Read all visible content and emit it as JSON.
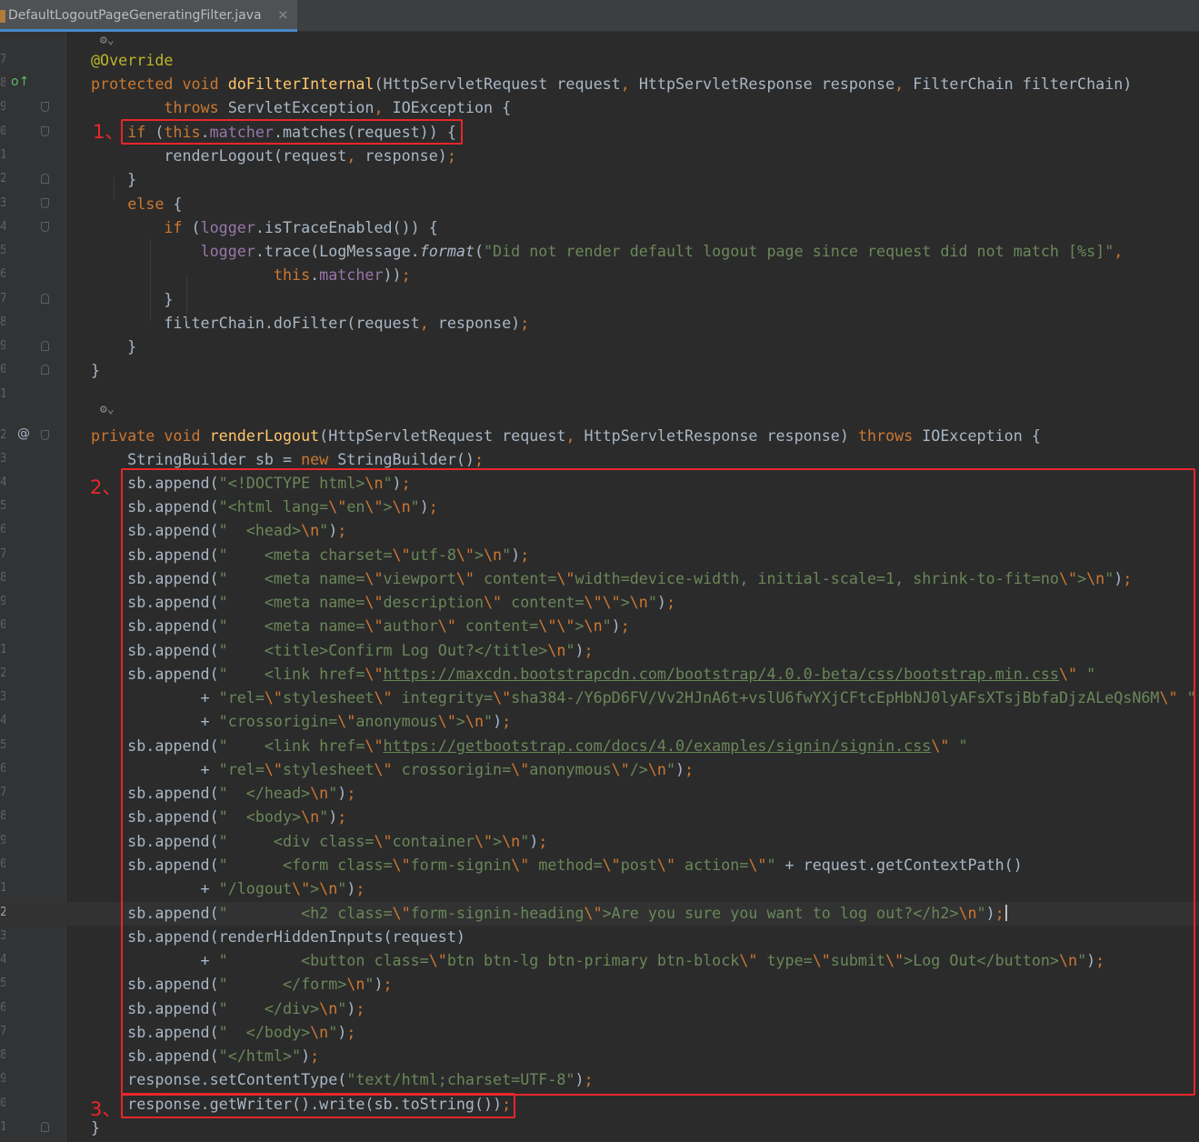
{
  "tab": {
    "filename": "DefaultLogoutPageGeneratingFilter.java",
    "close": "×"
  },
  "gutter_marks": {
    "override": "o↑",
    "annotation": "@"
  },
  "annotations": [
    "1、",
    "2、",
    "3、"
  ],
  "theme": {
    "background": "#2b2b2b",
    "keyword": "#cc7832",
    "string": "#6a8759",
    "method": "#ffc66d",
    "field": "#9876aa",
    "annotation": "#bbb529",
    "highlight": "#e8262b"
  },
  "lines": [
    {
      "n": "",
      "hint": "⚙⌄",
      "tokens": []
    },
    {
      "n": "7",
      "tokens": [
        [
          "a",
          "@Override"
        ]
      ]
    },
    {
      "n": "8",
      "mark": "override",
      "tokens": [
        [
          "k",
          "protected void "
        ],
        [
          "f",
          "doFilterInternal"
        ],
        [
          "p",
          "(HttpServletRequest request"
        ],
        [
          "k",
          ", "
        ],
        [
          "p",
          "HttpServletResponse response"
        ],
        [
          "k",
          ", "
        ],
        [
          "p",
          "FilterChain filterChain)"
        ]
      ]
    },
    {
      "n": "9",
      "fold": "down",
      "tokens": [
        [
          "p",
          "        "
        ],
        [
          "k",
          "throws "
        ],
        [
          "p",
          "ServletException"
        ],
        [
          "k",
          ", "
        ],
        [
          "p",
          "IOException {"
        ]
      ]
    },
    {
      "n": "0",
      "fold": "down",
      "tokens": [
        [
          "p",
          "    "
        ],
        [
          "k",
          "if "
        ],
        [
          "p",
          "("
        ],
        [
          "k",
          "this"
        ],
        [
          "p",
          "."
        ],
        [
          "m",
          "matcher"
        ],
        [
          "p",
          ".matches(request)) {"
        ]
      ]
    },
    {
      "n": "1",
      "tokens": [
        [
          "p",
          "        renderLogout(request"
        ],
        [
          "k",
          ", "
        ],
        [
          "p",
          "response)"
        ],
        [
          "k",
          ";"
        ]
      ]
    },
    {
      "n": "2",
      "fold": "up",
      "tokens": [
        [
          "p",
          "    }"
        ]
      ]
    },
    {
      "n": "3",
      "fold": "down",
      "tokens": [
        [
          "p",
          "    "
        ],
        [
          "k",
          "else "
        ],
        [
          "p",
          "{"
        ]
      ]
    },
    {
      "n": "4",
      "fold": "down",
      "tokens": [
        [
          "p",
          "        "
        ],
        [
          "k",
          "if "
        ],
        [
          "p",
          "("
        ],
        [
          "m",
          "logger"
        ],
        [
          "p",
          ".isTraceEnabled()) {"
        ]
      ]
    },
    {
      "n": "5",
      "tokens": [
        [
          "p",
          "            "
        ],
        [
          "m",
          "logger"
        ],
        [
          "p",
          ".trace(LogMessage."
        ],
        [
          "i",
          "format"
        ],
        [
          "p",
          "("
        ],
        [
          "s",
          "\"Did not render default logout page since request did not match [%s]\""
        ],
        [
          "k",
          ","
        ]
      ]
    },
    {
      "n": "6",
      "tokens": [
        [
          "p",
          "                    "
        ],
        [
          "k",
          "this"
        ],
        [
          "p",
          "."
        ],
        [
          "m",
          "matcher"
        ],
        [
          "p",
          "))"
        ],
        [
          "k",
          ";"
        ]
      ]
    },
    {
      "n": "7",
      "fold": "up",
      "tokens": [
        [
          "p",
          "        }"
        ]
      ]
    },
    {
      "n": "8",
      "tokens": [
        [
          "p",
          "        filterChain.doFilter(request"
        ],
        [
          "k",
          ", "
        ],
        [
          "p",
          "response)"
        ],
        [
          "k",
          ";"
        ]
      ]
    },
    {
      "n": "9",
      "fold": "up",
      "tokens": [
        [
          "p",
          "    }"
        ]
      ]
    },
    {
      "n": "0",
      "fold": "up",
      "tokens": [
        [
          "p",
          "}"
        ]
      ]
    },
    {
      "n": "1",
      "tokens": []
    },
    {
      "n": "",
      "hint": "⚙⌄",
      "tokens": []
    },
    {
      "n": "2",
      "mark": "annotation",
      "fold": "down",
      "tokens": [
        [
          "k",
          "private void "
        ],
        [
          "f",
          "renderLogout"
        ],
        [
          "p",
          "(HttpServletRequest request"
        ],
        [
          "k",
          ", "
        ],
        [
          "p",
          "HttpServletResponse response) "
        ],
        [
          "k",
          "throws "
        ],
        [
          "p",
          "IOException {"
        ]
      ]
    },
    {
      "n": "3",
      "tokens": [
        [
          "p",
          "    StringBuilder sb = "
        ],
        [
          "k",
          "new "
        ],
        [
          "p",
          "StringBuilder()"
        ],
        [
          "k",
          ";"
        ]
      ]
    },
    {
      "n": "4",
      "tokens": [
        [
          "p",
          "    sb.append("
        ],
        [
          "s",
          "\"<!DOCTYPE html>"
        ],
        [
          "k",
          "\\n"
        ],
        [
          "s",
          "\""
        ],
        [
          "p",
          ")"
        ],
        [
          "k",
          ";"
        ]
      ]
    },
    {
      "n": "5",
      "tokens": [
        [
          "p",
          "    sb.append("
        ],
        [
          "s",
          "\"<html lang="
        ],
        [
          "k",
          "\\\""
        ],
        [
          "s",
          "en"
        ],
        [
          "k",
          "\\\""
        ],
        [
          "s",
          ">"
        ],
        [
          "k",
          "\\n"
        ],
        [
          "s",
          "\""
        ],
        [
          "p",
          ")"
        ],
        [
          "k",
          ";"
        ]
      ]
    },
    {
      "n": "6",
      "tokens": [
        [
          "p",
          "    sb.append("
        ],
        [
          "s",
          "\"  <head>"
        ],
        [
          "k",
          "\\n"
        ],
        [
          "s",
          "\""
        ],
        [
          "p",
          ")"
        ],
        [
          "k",
          ";"
        ]
      ]
    },
    {
      "n": "7",
      "tokens": [
        [
          "p",
          "    sb.append("
        ],
        [
          "s",
          "\"    <meta charset="
        ],
        [
          "k",
          "\\\""
        ],
        [
          "s",
          "utf-8"
        ],
        [
          "k",
          "\\\""
        ],
        [
          "s",
          ">"
        ],
        [
          "k",
          "\\n"
        ],
        [
          "s",
          "\""
        ],
        [
          "p",
          ")"
        ],
        [
          "k",
          ";"
        ]
      ]
    },
    {
      "n": "8",
      "tokens": [
        [
          "p",
          "    sb.append("
        ],
        [
          "s",
          "\"    <meta name="
        ],
        [
          "k",
          "\\\""
        ],
        [
          "s",
          "viewport"
        ],
        [
          "k",
          "\\\""
        ],
        [
          "s",
          " content="
        ],
        [
          "k",
          "\\\""
        ],
        [
          "s",
          "width=device-width, initial-scale=1, shrink-to-fit=no"
        ],
        [
          "k",
          "\\\""
        ],
        [
          "s",
          ">"
        ],
        [
          "k",
          "\\n"
        ],
        [
          "s",
          "\""
        ],
        [
          "p",
          ")"
        ],
        [
          "k",
          ";"
        ]
      ]
    },
    {
      "n": "9",
      "tokens": [
        [
          "p",
          "    sb.append("
        ],
        [
          "s",
          "\"    <meta name="
        ],
        [
          "k",
          "\\\""
        ],
        [
          "s",
          "description"
        ],
        [
          "k",
          "\\\""
        ],
        [
          "s",
          " content="
        ],
        [
          "k",
          "\\\"\\\""
        ],
        [
          "s",
          ">"
        ],
        [
          "k",
          "\\n"
        ],
        [
          "s",
          "\""
        ],
        [
          "p",
          ")"
        ],
        [
          "k",
          ";"
        ]
      ]
    },
    {
      "n": "0",
      "tokens": [
        [
          "p",
          "    sb.append("
        ],
        [
          "s",
          "\"    <meta name="
        ],
        [
          "k",
          "\\\""
        ],
        [
          "s",
          "author"
        ],
        [
          "k",
          "\\\""
        ],
        [
          "s",
          " content="
        ],
        [
          "k",
          "\\\"\\\""
        ],
        [
          "s",
          ">"
        ],
        [
          "k",
          "\\n"
        ],
        [
          "s",
          "\""
        ],
        [
          "p",
          ")"
        ],
        [
          "k",
          ";"
        ]
      ]
    },
    {
      "n": "1",
      "tokens": [
        [
          "p",
          "    sb.append("
        ],
        [
          "s",
          "\"    <title>Confirm Log Out?</title>"
        ],
        [
          "k",
          "\\n"
        ],
        [
          "s",
          "\""
        ],
        [
          "p",
          ")"
        ],
        [
          "k",
          ";"
        ]
      ]
    },
    {
      "n": "2",
      "tokens": [
        [
          "p",
          "    sb.append("
        ],
        [
          "s",
          "\"    <link href="
        ],
        [
          "k",
          "\\\""
        ],
        [
          "u",
          "https://maxcdn.bootstrapcdn.com/bootstrap/4.0.0-beta/css/bootstrap.min.css"
        ],
        [
          "k",
          "\\\""
        ],
        [
          "s",
          " \""
        ]
      ]
    },
    {
      "n": "3",
      "tokens": [
        [
          "p",
          "            + "
        ],
        [
          "s",
          "\"rel="
        ],
        [
          "k",
          "\\\""
        ],
        [
          "s",
          "stylesheet"
        ],
        [
          "k",
          "\\\""
        ],
        [
          "s",
          " integrity="
        ],
        [
          "k",
          "\\\""
        ],
        [
          "s",
          "sha384-/Y6pD6FV/Vv2HJnA6t+vslU6fwYXjCFtcEpHbNJ0lyAFsXTsjBbfaDjzALeQsN6M"
        ],
        [
          "k",
          "\\\""
        ],
        [
          "s",
          " \""
        ]
      ]
    },
    {
      "n": "4",
      "tokens": [
        [
          "p",
          "            + "
        ],
        [
          "s",
          "\"crossorigin="
        ],
        [
          "k",
          "\\\""
        ],
        [
          "s",
          "anonymous"
        ],
        [
          "k",
          "\\\""
        ],
        [
          "s",
          ">"
        ],
        [
          "k",
          "\\n"
        ],
        [
          "s",
          "\""
        ],
        [
          "p",
          ")"
        ],
        [
          "k",
          ";"
        ]
      ]
    },
    {
      "n": "5",
      "tokens": [
        [
          "p",
          "    sb.append("
        ],
        [
          "s",
          "\"    <link href="
        ],
        [
          "k",
          "\\\""
        ],
        [
          "u",
          "https://getbootstrap.com/docs/4.0/examples/signin/signin.css"
        ],
        [
          "k",
          "\\\""
        ],
        [
          "s",
          " \""
        ]
      ]
    },
    {
      "n": "6",
      "tokens": [
        [
          "p",
          "            + "
        ],
        [
          "s",
          "\"rel="
        ],
        [
          "k",
          "\\\""
        ],
        [
          "s",
          "stylesheet"
        ],
        [
          "k",
          "\\\""
        ],
        [
          "s",
          " crossorigin="
        ],
        [
          "k",
          "\\\""
        ],
        [
          "s",
          "anonymous"
        ],
        [
          "k",
          "\\\""
        ],
        [
          "s",
          "/>"
        ],
        [
          "k",
          "\\n"
        ],
        [
          "s",
          "\""
        ],
        [
          "p",
          ")"
        ],
        [
          "k",
          ";"
        ]
      ]
    },
    {
      "n": "7",
      "tokens": [
        [
          "p",
          "    sb.append("
        ],
        [
          "s",
          "\"  </head>"
        ],
        [
          "k",
          "\\n"
        ],
        [
          "s",
          "\""
        ],
        [
          "p",
          ")"
        ],
        [
          "k",
          ";"
        ]
      ]
    },
    {
      "n": "8",
      "tokens": [
        [
          "p",
          "    sb.append("
        ],
        [
          "s",
          "\"  <body>"
        ],
        [
          "k",
          "\\n"
        ],
        [
          "s",
          "\""
        ],
        [
          "p",
          ")"
        ],
        [
          "k",
          ";"
        ]
      ]
    },
    {
      "n": "9",
      "tokens": [
        [
          "p",
          "    sb.append("
        ],
        [
          "s",
          "\"     <div class="
        ],
        [
          "k",
          "\\\""
        ],
        [
          "s",
          "container"
        ],
        [
          "k",
          "\\\""
        ],
        [
          "s",
          ">"
        ],
        [
          "k",
          "\\n"
        ],
        [
          "s",
          "\""
        ],
        [
          "p",
          ")"
        ],
        [
          "k",
          ";"
        ]
      ]
    },
    {
      "n": "0",
      "tokens": [
        [
          "p",
          "    sb.append("
        ],
        [
          "s",
          "\"      <form class="
        ],
        [
          "k",
          "\\\""
        ],
        [
          "s",
          "form-signin"
        ],
        [
          "k",
          "\\\""
        ],
        [
          "s",
          " method="
        ],
        [
          "k",
          "\\\""
        ],
        [
          "s",
          "post"
        ],
        [
          "k",
          "\\\""
        ],
        [
          "s",
          " action="
        ],
        [
          "k",
          "\\\""
        ],
        [
          "s",
          "\""
        ],
        [
          "p",
          " + request.getContextPath()"
        ]
      ]
    },
    {
      "n": "1",
      "tokens": [
        [
          "p",
          "            + "
        ],
        [
          "s",
          "\"/logout"
        ],
        [
          "k",
          "\\\""
        ],
        [
          "s",
          ">"
        ],
        [
          "k",
          "\\n"
        ],
        [
          "s",
          "\""
        ],
        [
          "p",
          ")"
        ],
        [
          "k",
          ";"
        ]
      ]
    },
    {
      "n": "2",
      "current": true,
      "tokens": [
        [
          "p",
          "    sb.append("
        ],
        [
          "s",
          "\"        <h2 class="
        ],
        [
          "k",
          "\\\""
        ],
        [
          "s",
          "form-signin-heading"
        ],
        [
          "k",
          "\\\""
        ],
        [
          "s",
          ">Are you sure you want to log out?</h2>"
        ],
        [
          "k",
          "\\n"
        ],
        [
          "s",
          "\""
        ],
        [
          "p",
          ")"
        ],
        [
          "k",
          ";"
        ]
      ]
    },
    {
      "n": "3",
      "tokens": [
        [
          "p",
          "    sb.append(renderHiddenInputs(request)"
        ]
      ]
    },
    {
      "n": "4",
      "tokens": [
        [
          "p",
          "            + "
        ],
        [
          "s",
          "\"        <button class="
        ],
        [
          "k",
          "\\\""
        ],
        [
          "s",
          "btn btn-lg btn-primary btn-block"
        ],
        [
          "k",
          "\\\""
        ],
        [
          "s",
          " type="
        ],
        [
          "k",
          "\\\""
        ],
        [
          "s",
          "submit"
        ],
        [
          "k",
          "\\\""
        ],
        [
          "s",
          ">Log Out</button>"
        ],
        [
          "k",
          "\\n"
        ],
        [
          "s",
          "\""
        ],
        [
          "p",
          ")"
        ],
        [
          "k",
          ";"
        ]
      ]
    },
    {
      "n": "5",
      "tokens": [
        [
          "p",
          "    sb.append("
        ],
        [
          "s",
          "\"      </form>"
        ],
        [
          "k",
          "\\n"
        ],
        [
          "s",
          "\""
        ],
        [
          "p",
          ")"
        ],
        [
          "k",
          ";"
        ]
      ]
    },
    {
      "n": "6",
      "tokens": [
        [
          "p",
          "    sb.append("
        ],
        [
          "s",
          "\"    </div>"
        ],
        [
          "k",
          "\\n"
        ],
        [
          "s",
          "\""
        ],
        [
          "p",
          ")"
        ],
        [
          "k",
          ";"
        ]
      ]
    },
    {
      "n": "7",
      "tokens": [
        [
          "p",
          "    sb.append("
        ],
        [
          "s",
          "\"  </body>"
        ],
        [
          "k",
          "\\n"
        ],
        [
          "s",
          "\""
        ],
        [
          "p",
          ")"
        ],
        [
          "k",
          ";"
        ]
      ]
    },
    {
      "n": "8",
      "tokens": [
        [
          "p",
          "    sb.append("
        ],
        [
          "s",
          "\"</html>\""
        ],
        [
          "p",
          ")"
        ],
        [
          "k",
          ";"
        ]
      ]
    },
    {
      "n": "9",
      "tokens": [
        [
          "p",
          "    response.setContentType("
        ],
        [
          "s",
          "\"text/html;charset=UTF-8\""
        ],
        [
          "p",
          ")"
        ],
        [
          "k",
          ";"
        ]
      ]
    },
    {
      "n": "0",
      "tokens": [
        [
          "p",
          "    response.getWriter().write(sb.toString())"
        ],
        [
          "k",
          ";"
        ]
      ]
    },
    {
      "n": "1",
      "fold": "up",
      "tokens": [
        [
          "p",
          "}"
        ]
      ]
    }
  ]
}
